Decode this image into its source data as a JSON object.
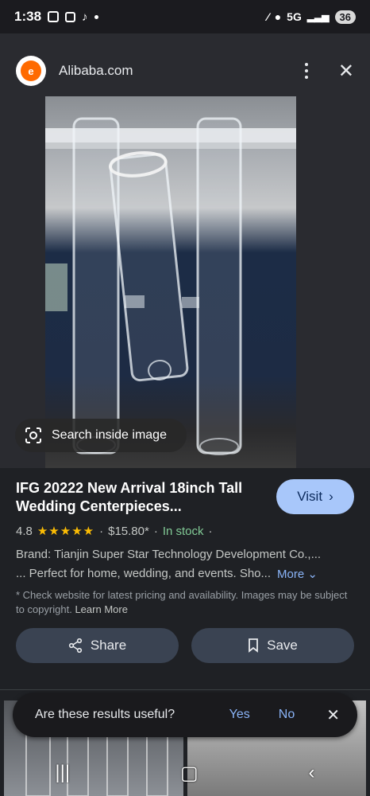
{
  "status_bar": {
    "time": "1:38",
    "network": "5G",
    "battery": "36"
  },
  "header": {
    "logo_glyph": "e",
    "site_name": "Alibaba.com"
  },
  "image": {
    "search_inside_label": "Search inside image"
  },
  "product": {
    "title_line1": "IFG 20222 New Arrival 18inch Tall",
    "title_line2": "Wedding Centerpieces...",
    "visit_label": "Visit",
    "rating": "4.8",
    "stars": "★★★★★",
    "price": "$15.80*",
    "stock": "In stock",
    "brand_line": "Brand: Tianjin Super Star Technology Development Co.,...",
    "description": "... Perfect for home, wedding, and events. Sho...",
    "more_label": "More",
    "disclaimer": "* Check website for latest pricing and availability. Images may be subject to copyright.",
    "learn_more": "Learn More"
  },
  "actions": {
    "share_label": "Share",
    "save_label": "Save"
  },
  "feedback": {
    "question": "Are these results useful?",
    "yes_label": "Yes",
    "no_label": "No"
  },
  "colors": {
    "accent_blue": "#a8c7fa",
    "link_blue": "#8ab4f8",
    "star_yellow": "#fbbc04",
    "stock_green": "#81c995",
    "alibaba_orange": "#ff6a00"
  }
}
